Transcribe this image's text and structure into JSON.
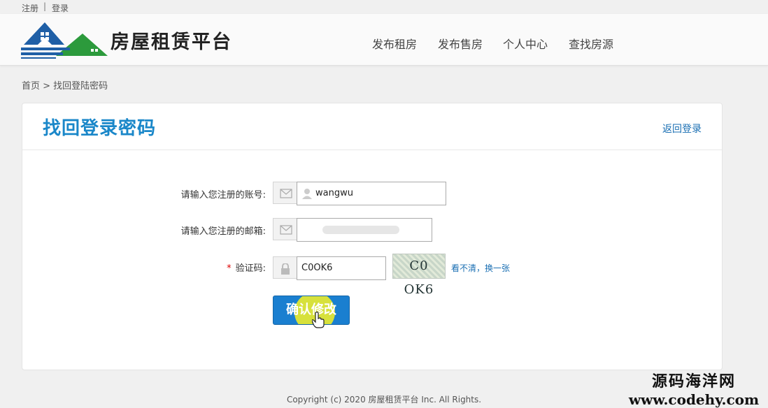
{
  "topbar": {
    "register": "注册",
    "separator": "|",
    "login": "登录"
  },
  "header": {
    "site_name": "房屋租赁平台",
    "nav": [
      "发布租房",
      "发布售房",
      "个人中心",
      "查找房源"
    ]
  },
  "breadcrumb": "首页 > 找回登陆密码",
  "card": {
    "title": "找回登录密码",
    "back_link": "返回登录",
    "fields": {
      "account_label": "请输入您注册的账号:",
      "account_value": "wangwu",
      "email_label": "请输入您注册的邮箱:",
      "email_value": "",
      "required_mark": "*",
      "captcha_label": "验证码:",
      "captcha_value": "C0OK6",
      "captcha_image_text": "C0 OK6",
      "refresh_link": "看不清，换一张"
    },
    "submit": "确认修改"
  },
  "footer": "Copyright (c) 2020 房屋租赁平台 Inc. All Rights.",
  "watermark": {
    "line1": "源码海洋网",
    "line2": "www.codehy.com"
  },
  "colors": {
    "accent": "#1a87c9",
    "button": "#1a7fd0",
    "link": "#1a6fb3"
  }
}
